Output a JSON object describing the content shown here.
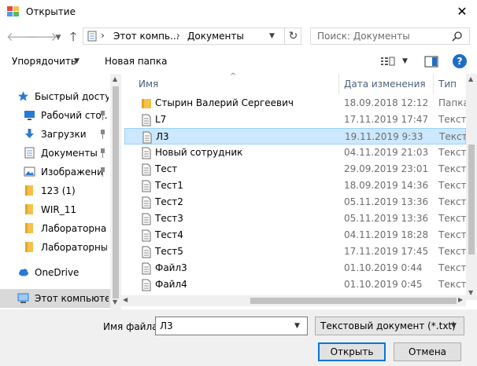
{
  "window": {
    "title": "Открытие",
    "close_glyph": "✕"
  },
  "nav": {
    "back_icon": "arrow-left-icon",
    "forward_icon": "arrow-right-icon",
    "up_icon": "arrow-up-icon",
    "address_segments": [
      "Этот компь...",
      "Документы"
    ],
    "search_placeholder": "Поиск: Документы"
  },
  "toolbar": {
    "organize_label": "Упорядочить",
    "new_folder_label": "Новая папка",
    "help_label": "?"
  },
  "sidebar": {
    "items": [
      {
        "label": "Быстрый доступ",
        "icon": "star-icon",
        "pinned": false,
        "level": "top"
      },
      {
        "label": "Рабочий сто...",
        "icon": "desktop-icon",
        "pinned": true,
        "level": "sub"
      },
      {
        "label": "Загрузки",
        "icon": "download-icon",
        "pinned": true,
        "level": "sub"
      },
      {
        "label": "Документы",
        "icon": "documents-icon",
        "pinned": true,
        "level": "sub"
      },
      {
        "label": "Изображени",
        "icon": "pictures-icon",
        "pinned": true,
        "level": "sub"
      },
      {
        "label": "123 (1)",
        "icon": "folder-icon",
        "pinned": false,
        "level": "sub"
      },
      {
        "label": "WIR_11",
        "icon": "folder-icon",
        "pinned": false,
        "level": "sub"
      },
      {
        "label": "Лабораторная N",
        "icon": "folder-icon",
        "pinned": false,
        "level": "sub"
      },
      {
        "label": "Лабораторные",
        "icon": "folder-icon",
        "pinned": false,
        "level": "sub"
      },
      {
        "label": "OneDrive",
        "icon": "cloud-icon",
        "pinned": false,
        "level": "top"
      },
      {
        "label": "Этот компьютер",
        "icon": "computer-icon",
        "pinned": false,
        "level": "top",
        "selected": true
      }
    ]
  },
  "files": {
    "columns": {
      "name": "Имя",
      "date": "Дата изменения",
      "type": "Тип"
    },
    "rows": [
      {
        "name": "Стырин Валерий Сергеевич",
        "date": "18.09.2018 12:12",
        "type": "Папка",
        "kind": "folder"
      },
      {
        "name": "L7",
        "date": "17.11.2019 17:47",
        "type": "Тексто",
        "kind": "text"
      },
      {
        "name": "Л3",
        "date": "19.11.2019 9:33",
        "type": "Тексто",
        "kind": "text",
        "selected": true
      },
      {
        "name": "Новый сотрудник",
        "date": "04.11.2019 21:03",
        "type": "Тексто",
        "kind": "text"
      },
      {
        "name": "Тест",
        "date": "29.09.2019 23:01",
        "type": "Тексто",
        "kind": "text"
      },
      {
        "name": "Тест1",
        "date": "18.09.2019 14:36",
        "type": "Тексто",
        "kind": "text"
      },
      {
        "name": "Тест2",
        "date": "05.11.2019 13:36",
        "type": "Тексто",
        "kind": "text"
      },
      {
        "name": "Тест3",
        "date": "05.11.2019 13:36",
        "type": "Тексто",
        "kind": "text"
      },
      {
        "name": "Тест4",
        "date": "04.11.2019 18:28",
        "type": "Тексто",
        "kind": "text"
      },
      {
        "name": "Тест5",
        "date": "17.11.2019 17:45",
        "type": "Тексто",
        "kind": "text"
      },
      {
        "name": "Файл3",
        "date": "01.10.2019 0:44",
        "type": "Тексто",
        "kind": "text"
      },
      {
        "name": "Файл4",
        "date": "01.10.2019 0:45",
        "type": "Тексто",
        "kind": "text"
      }
    ]
  },
  "bottom": {
    "filename_label": "Имя файла:",
    "filename_value": "Л3",
    "filetype_value": "Текстовый документ (*.txt)",
    "open_label": "Открыть",
    "cancel_label": "Отмена"
  },
  "colors": {
    "accent": "#0078d7",
    "selection": "#cce8ff",
    "folder": "#f4c14a",
    "help": "#1d6fc6"
  }
}
